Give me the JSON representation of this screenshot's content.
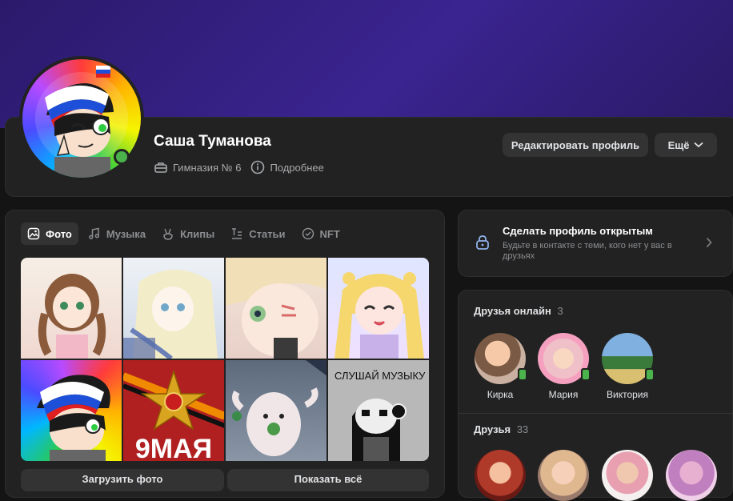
{
  "profile": {
    "name": "Саша Туманова",
    "school": "Гимназия № 6",
    "more_info": "Подробнее",
    "edit_button": "Редактировать профиль",
    "more_button": "Ещё"
  },
  "tabs": [
    {
      "label": "Фото",
      "icon": "image-icon",
      "active": true
    },
    {
      "label": "Музыка",
      "icon": "music-note-icon",
      "active": false
    },
    {
      "label": "Клипы",
      "icon": "clips-icon",
      "active": false
    },
    {
      "label": "Статьи",
      "icon": "article-icon",
      "active": false
    },
    {
      "label": "NFT",
      "icon": "check-badge-icon",
      "active": false
    }
  ],
  "photos": {
    "upload_button": "Загрузить фото",
    "show_all_button": "Показать всё",
    "items": [
      {
        "name": "photo-anime-girl-brown-hair"
      },
      {
        "name": "photo-anime-girl-sketch"
      },
      {
        "name": "photo-anime-girl-closeup"
      },
      {
        "name": "photo-anime-girl-blonde"
      },
      {
        "name": "photo-avatar-rainbow"
      },
      {
        "name": "photo-victory-day-9-may",
        "text": "9МАЯ"
      },
      {
        "name": "photo-clay-figure"
      },
      {
        "name": "photo-listen-music-drawing",
        "text": "СЛУШАЙ МУЗЫКУ"
      }
    ]
  },
  "privacy": {
    "title": "Сделать профиль открытым",
    "description": "Будьте в контакте с теми, кого нет у вас в друзьях"
  },
  "friends_online": {
    "label": "Друзья онлайн",
    "count": "3",
    "items": [
      {
        "name": "Кирка"
      },
      {
        "name": "Мария"
      },
      {
        "name": "Виктория"
      }
    ]
  },
  "friends": {
    "label": "Друзья",
    "count": "33"
  },
  "colors": {
    "accent_online": "#4bb34b",
    "cover": "#3a2490",
    "card_bg": "#222222"
  }
}
